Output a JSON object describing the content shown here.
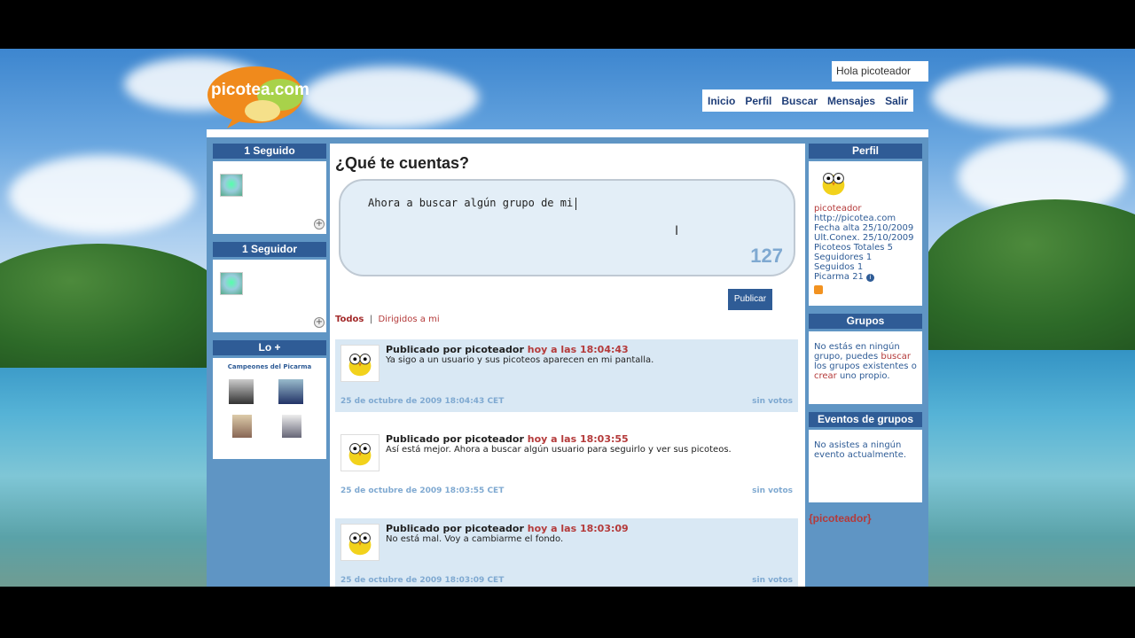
{
  "header": {
    "greeting": "Hola picoteador",
    "nav": [
      "Inicio",
      "Perfil",
      "Buscar",
      "Mensajes",
      "Salir"
    ]
  },
  "left": {
    "following_title": "1 Seguido",
    "followers_title": "1 Seguidor",
    "top_title": "Lo +",
    "top_subtitle": "Campeones del Picarma"
  },
  "composer": {
    "question": "¿Qué te cuentas?",
    "text": "Ahora a buscar algún grupo de mi",
    "counter": "127",
    "publish": "Publicar"
  },
  "filters": {
    "all": "Todos",
    "sep": "|",
    "directed": "Dirigidos a mi"
  },
  "posts": [
    {
      "author": "Publicado por picoteador",
      "time": "hoy a las 18:04:43",
      "body": "Ya sigo a un usuario y sus picoteos aparecen en mi pantalla.",
      "date": "25 de octubre de 2009 18:04:43 CET",
      "votes": "sin votos"
    },
    {
      "author": "Publicado por picoteador",
      "time": "hoy a las 18:03:55",
      "body": "Así está mejor. Ahora a buscar algún usuario para seguirlo y ver sus picoteos.",
      "date": "25 de octubre de 2009 18:03:55 CET",
      "votes": "sin votos"
    },
    {
      "author": "Publicado por picoteador",
      "time": "hoy a las 18:03:09",
      "body": "No está mal. Voy a cambiarme el fondo.",
      "date": "25 de octubre de 2009 18:03:09 CET",
      "votes": "sin votos"
    }
  ],
  "profile": {
    "title": "Perfil",
    "name": "picoteador",
    "url": "http://picotea.com",
    "alta": "Fecha alta 25/10/2009",
    "ultconex": "Ult.Conex. 25/10/2009",
    "picoteos": "Picoteos Totales 5",
    "seguidores": "Seguidores 1",
    "seguidos": "Seguidos 1",
    "picarma": "Picarma 21"
  },
  "groups": {
    "title": "Grupos",
    "text1": "No estás en ningún grupo, puedes",
    "search_link": "buscar",
    "text2": "los grupos existentes o",
    "create_link": "crear",
    "text3": "uno propio."
  },
  "events": {
    "title": "Eventos de grupos",
    "text": "No asistes a ningún evento actualmente."
  },
  "tag": "{picoteador}",
  "colors": {
    "accent": "#2f5c96",
    "link": "#b43a3a",
    "light": "#d9e8f4"
  }
}
